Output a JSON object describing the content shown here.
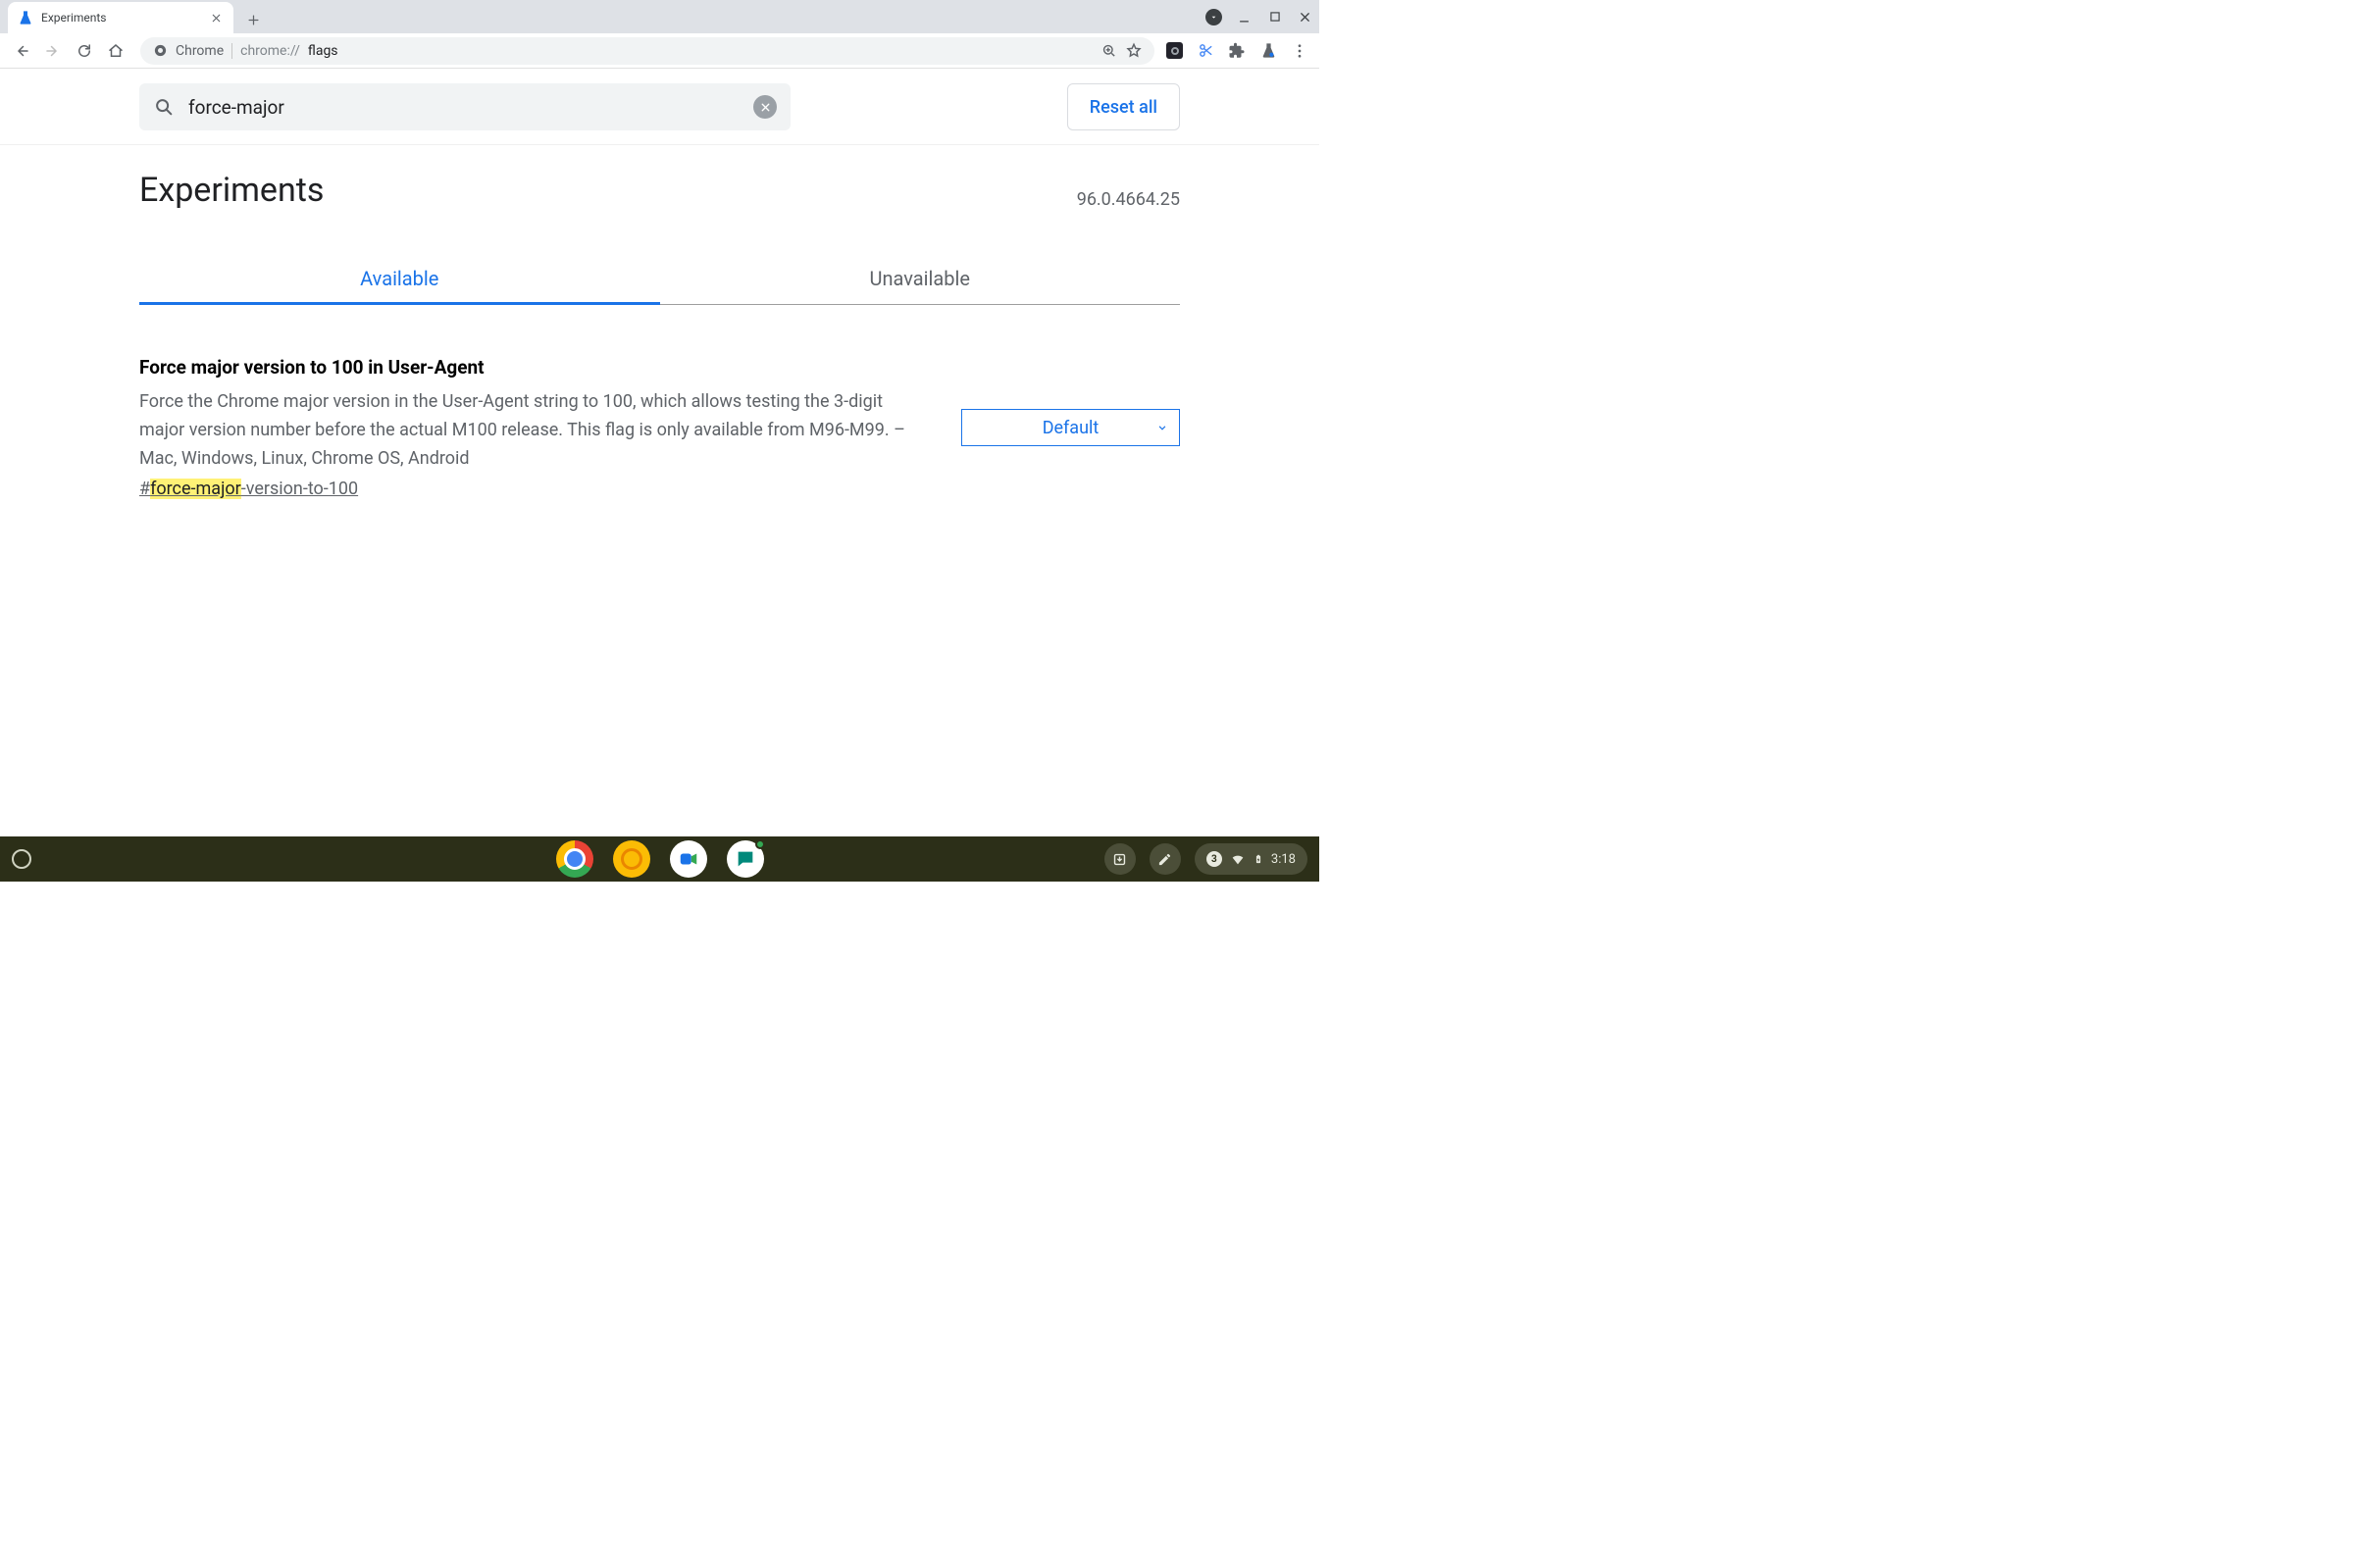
{
  "browser": {
    "tab_title": "Experiments",
    "omnibox_chip": "Chrome",
    "omnibox_url_prefix": "chrome://",
    "omnibox_url_path": "flags"
  },
  "search": {
    "value": "force-major",
    "reset_label": "Reset all"
  },
  "page": {
    "heading": "Experiments",
    "version": "96.0.4664.25",
    "tab_available": "Available",
    "tab_unavailable": "Unavailable"
  },
  "flag": {
    "title": "Force major version to 100 in User-Agent",
    "description": "Force the Chrome major version in the User-Agent string to 100, which allows testing the 3-digit major version number before the actual M100 release. This flag is only available from M96-M99. – Mac, Windows, Linux, Chrome OS, Android",
    "anchor_prefix": "#",
    "anchor_highlight": "force-major",
    "anchor_suffix": "-version-to-100",
    "select_value": "Default"
  },
  "shelf": {
    "notification_count": "3",
    "time": "3:18"
  }
}
